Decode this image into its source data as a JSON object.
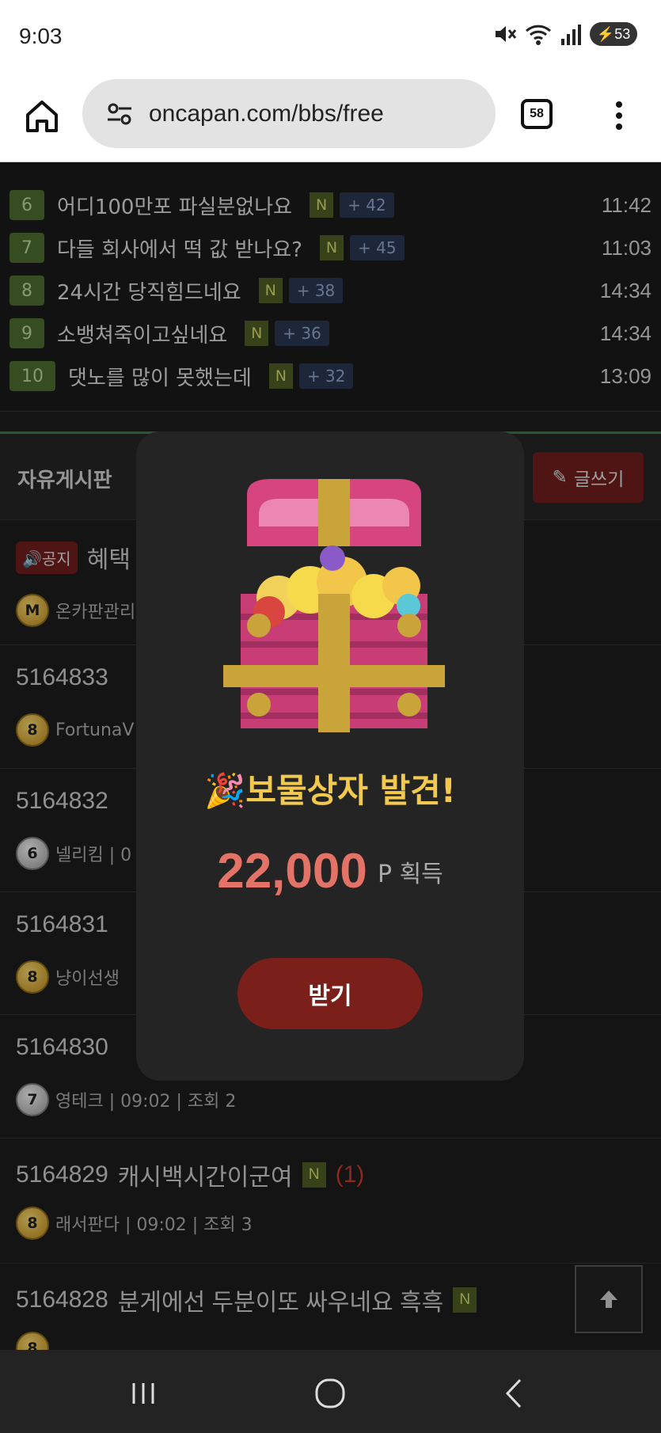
{
  "status_bar": {
    "time": "9:03",
    "battery": "53",
    "signal_label": "5"
  },
  "browser": {
    "url": "oncapan.com/bbs/free",
    "tab_count": "58"
  },
  "popular_list": [
    {
      "rank": "6",
      "title": "어디100만포 파실분없나요",
      "new": "N",
      "comments": "+ 42",
      "time": "11:42"
    },
    {
      "rank": "7",
      "title": "다들 회사에서 떡 값 받나요?",
      "new": "N",
      "comments": "+ 45",
      "time": "11:03"
    },
    {
      "rank": "8",
      "title": "24시간 당직힘드네요",
      "new": "N",
      "comments": "+ 38",
      "time": "14:34"
    },
    {
      "rank": "9",
      "title": "소뱅쳐죽이고싶네요",
      "new": "N",
      "comments": "+ 36",
      "time": "14:34"
    },
    {
      "rank": "10",
      "title": "댓노를 많이 못했는데",
      "new": "N",
      "comments": "+ 32",
      "time": "13:09"
    }
  ],
  "board": {
    "title": "자유게시판",
    "write_label": "글쓰기"
  },
  "posts": [
    {
      "id": "notice",
      "notice_label": "공지",
      "title": "혜택",
      "level": "M",
      "meta": "온카판관리"
    },
    {
      "id": "5164833",
      "title": "",
      "level": "8",
      "meta": "FortunaV"
    },
    {
      "id": "5164832",
      "title": "",
      "level": "6",
      "meta": "넬리킴 | 0"
    },
    {
      "id": "5164831",
      "title": "",
      "level": "8",
      "meta": "냥이선생"
    },
    {
      "id": "5164830",
      "title": "",
      "level": "7",
      "meta": "영테크 | 09:02 | 조회 2"
    },
    {
      "id": "5164829",
      "title": "캐시백시간이군여",
      "new": "N",
      "replies": "(1)",
      "level": "8",
      "meta": "래서판다 | 09:02 | 조회 3"
    },
    {
      "id": "5164828",
      "title": "분게에선 두분이또 싸우네요 흑흑",
      "new": "N",
      "level": "8",
      "meta": ""
    }
  ],
  "modal": {
    "title": "🎉보물상자 발견!",
    "amount": "22,000",
    "unit": "P 획득",
    "button_label": "받기"
  },
  "colors": {
    "accent_red": "#7b1f1a",
    "gold": "#f2c94c",
    "amount_red": "#e47367"
  }
}
